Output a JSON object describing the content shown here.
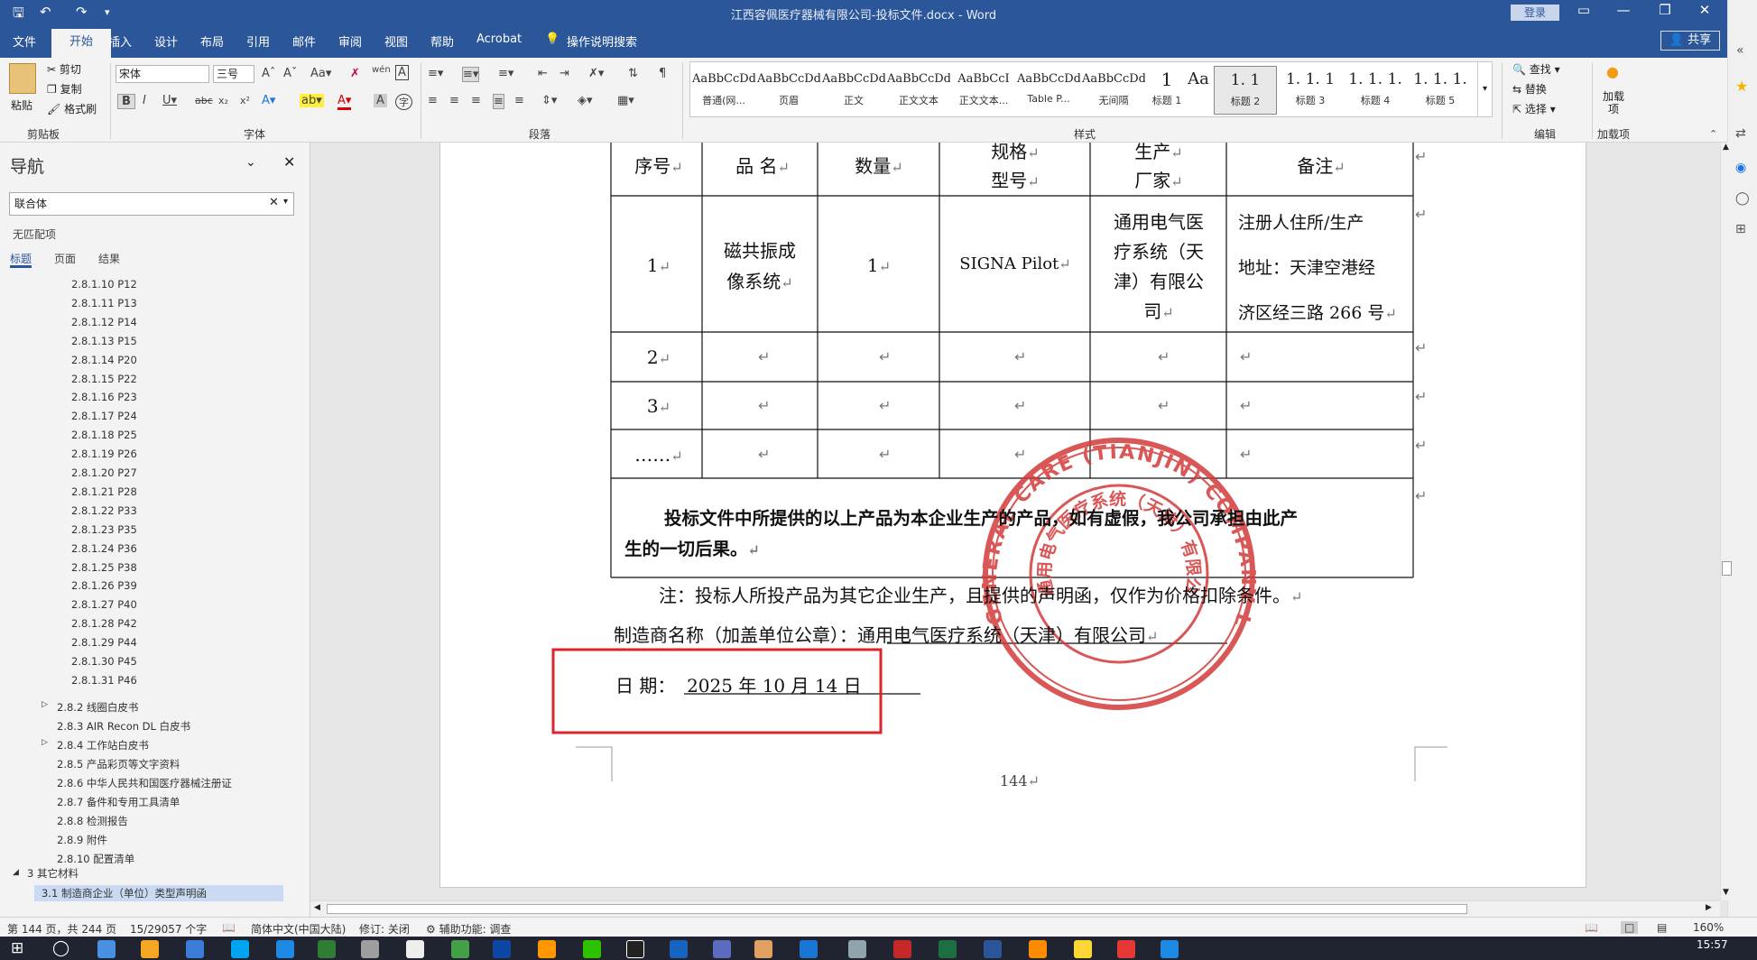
{
  "window": {
    "title": "江西容佩医疗器械有限公司-投标文件.docx  -  Word",
    "login_label": "登录",
    "share_label": "共享"
  },
  "tabs": [
    "文件",
    "开始",
    "插入",
    "设计",
    "布局",
    "引用",
    "邮件",
    "审阅",
    "视图",
    "帮助",
    "Acrobat"
  ],
  "tell_me": "操作说明搜索",
  "ribbon": {
    "clipboard": {
      "paste": "粘贴",
      "cut": "剪切",
      "copy": "复制",
      "format_painter": "格式刷",
      "label": "剪贴板"
    },
    "font": {
      "name": "宋体",
      "size": "三号",
      "label": "字体"
    },
    "paragraph": {
      "label": "段落"
    },
    "styles": {
      "label": "样式",
      "items": [
        {
          "preview": "AaBbCcDd",
          "name": "普通(网..."
        },
        {
          "preview": "AaBbCcDdl",
          "name": "页眉"
        },
        {
          "preview": "AaBbCcDd",
          "name": "正文"
        },
        {
          "preview": "AaBbCcDd",
          "name": "正文文本"
        },
        {
          "preview": "AaBbCcI",
          "name": "正文文本..."
        },
        {
          "preview": "AaBbCcDdl",
          "name": "Table P..."
        },
        {
          "preview": "AaBbCcDd",
          "name": "无间隔"
        },
        {
          "preview": "1",
          "name": "标题 1"
        },
        {
          "preview": "Aa",
          "name": ""
        },
        {
          "preview": "1. 1",
          "name": "标题 2"
        },
        {
          "preview": "1. 1. 1",
          "name": "标题 3"
        },
        {
          "preview": "1. 1. 1.",
          "name": "标题 4"
        },
        {
          "preview": "1. 1. 1.",
          "name": "标题 5"
        }
      ]
    },
    "editing": {
      "find": "查找",
      "replace": "替换",
      "select": "选择",
      "label": "编辑"
    },
    "addins": {
      "load": "加载项",
      "label": "加载项"
    }
  },
  "nav": {
    "title": "导航",
    "search_value": "联合体",
    "no_match": "无匹配项",
    "tabs": [
      "标题",
      "页面",
      "结果"
    ],
    "items": [
      "2.8.1.10 P12",
      "2.8.1.11 P13",
      "2.8.1.12 P14",
      "2.8.1.13 P15",
      "2.8.1.14 P20",
      "2.8.1.15 P22",
      "2.8.1.16 P23",
      "2.8.1.17 P24",
      "2.8.1.18 P25",
      "2.8.1.19 P26",
      "2.8.1.20 P27",
      "2.8.1.21 P28",
      "2.8.1.22 P33",
      "2.8.1.23 P35",
      "2.8.1.24 P36",
      "2.8.1.25 P38",
      "2.8.1.26 P39",
      "2.8.1.27 P40",
      "2.8.1.28 P42",
      "2.8.1.29 P44",
      "2.8.1.30 P45",
      "2.8.1.31 P46"
    ],
    "items_lvl2": [
      "2.8.2 线圈白皮书",
      "2.8.3 AIR Recon DL 白皮书",
      "2.8.4 工作站白皮书",
      "2.8.5 产品彩页等文字资料",
      "2.8.6 中华人民共和国医疗器械注册证",
      "2.8.7 备件和专用工具清单",
      "2.8.8 检测报告",
      "2.8.9 附件",
      "2.8.10 配置清单"
    ],
    "section": "3 其它材料",
    "selected": "3.1 制造商企业（单位）类型声明函"
  },
  "document": {
    "headers": [
      "序号",
      "品  名",
      "数量",
      "规格",
      "型号",
      "生产",
      "厂家",
      "备注"
    ],
    "row1": {
      "no": "1",
      "name_a": "磁共振成",
      "name_b": "像系统",
      "qty": "1",
      "model": "SIGNA Pilot",
      "maker_a": "通用电气医",
      "maker_b": "疗系统（天",
      "maker_c": "津）有限公",
      "maker_d": "司",
      "note_a": "注册人住所/生产",
      "note_b": "地址：天津空港经",
      "note_c": "济区经三路 266 号"
    },
    "row2_no": "2",
    "row3_no": "3",
    "row4_no": "……",
    "statement_a": "投标文件中所提供的以上产品为本企业生产的产品，如有虚假，我公司承担由此产",
    "statement_b": "生的一切后果。",
    "note": "注：投标人所投产品为其它企业生产，且提供的声明函，仅作为价格扣除条件。",
    "maker_label": "制造商名称（加盖单位公章）：",
    "maker_value": "通用电气医疗系统（天津）有限公司",
    "date_label": "日  期：",
    "date_value": "2025 年 10 月 14 日",
    "page_number": "144",
    "stamp_outer": "GENERAL CARE (TIANJIN) COMPANY LIMITED",
    "stamp_inner": "通用电气医疗系统（天津）有限公司"
  },
  "status": {
    "page": "第 144 页，共 244 页",
    "words": "15/29057 个字",
    "lang": "简体中文(中国大陆)",
    "track": "修订: 关闭",
    "access": "辅助功能: 调查",
    "zoom": "160%"
  },
  "clock": "15:57",
  "colors": {
    "accent": "#2b579a",
    "highlight_box": "#d9262c",
    "stamp": "#d43a3a"
  }
}
